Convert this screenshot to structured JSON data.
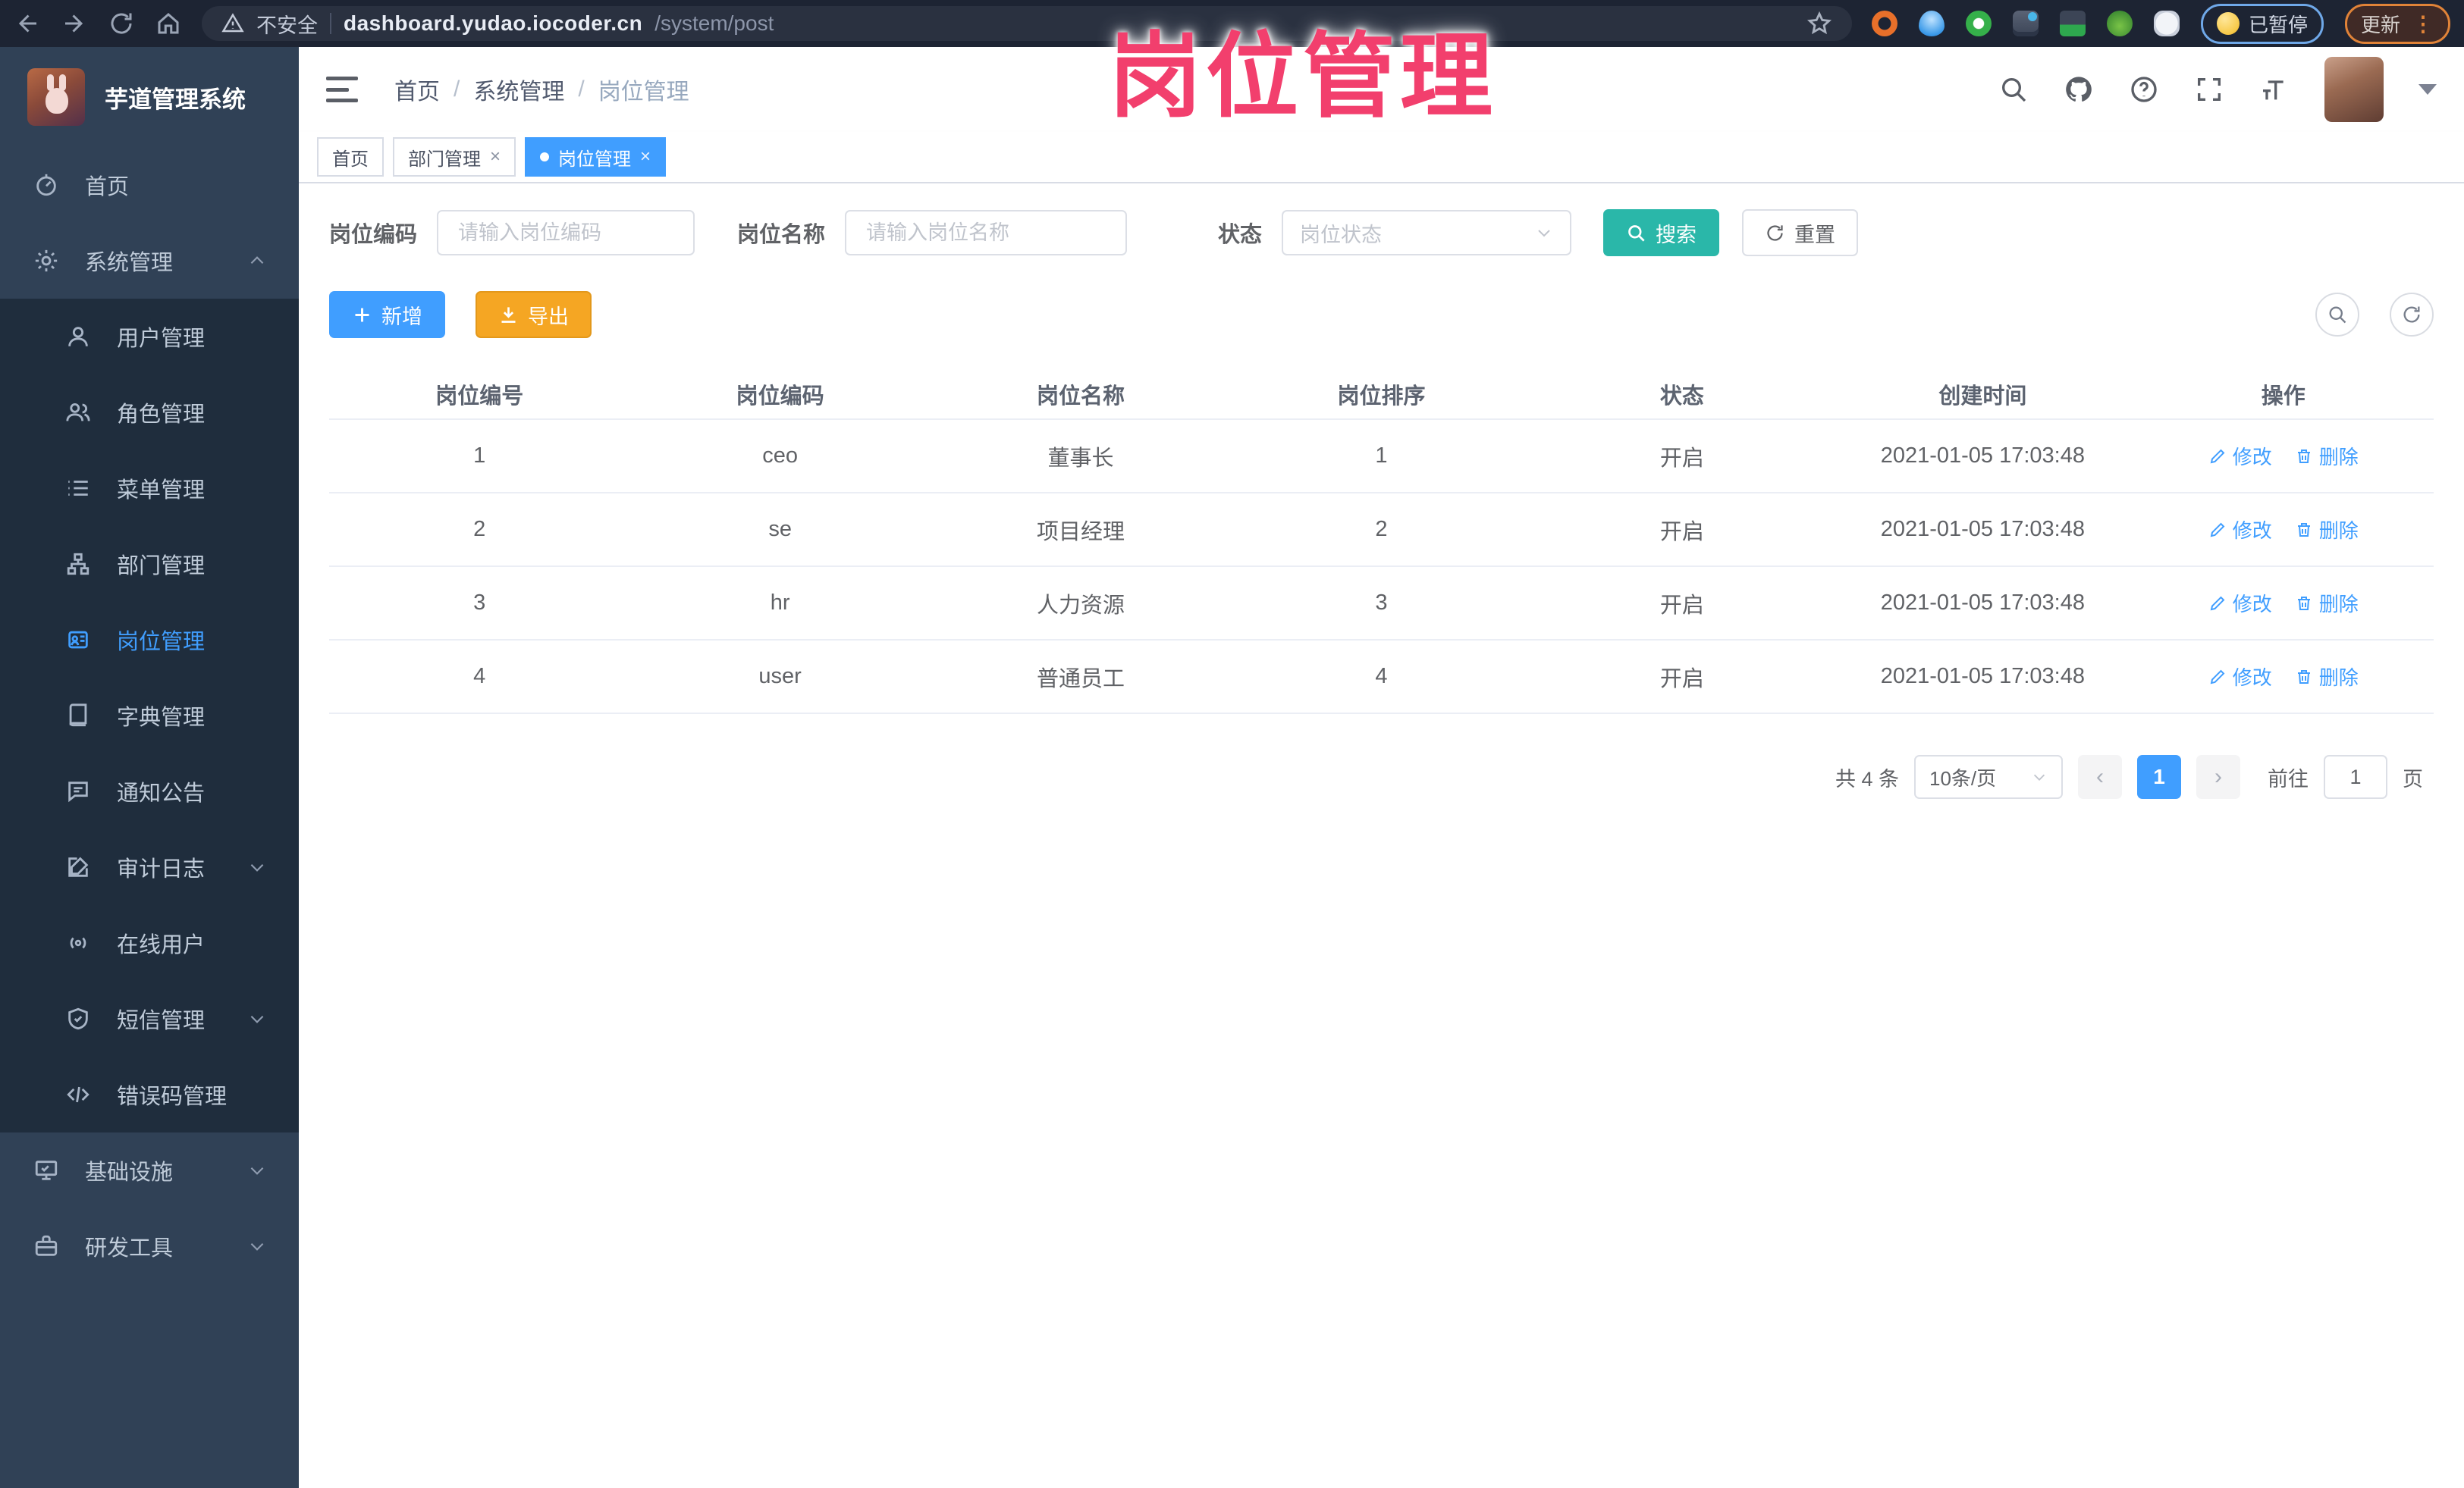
{
  "watermark_text": "岗位管理",
  "browser": {
    "security_label": "不安全",
    "url_host": "dashboard.yudao.iocoder.cn",
    "url_path": "/system/post",
    "paused_badge": "已暂停",
    "update_button": "更新",
    "kebab": "⋮"
  },
  "sidebar": {
    "app_title": "芋道管理系统",
    "menu": [
      {
        "label": "首页"
      },
      {
        "label": "系统管理"
      },
      {
        "label": "用户管理"
      },
      {
        "label": "角色管理"
      },
      {
        "label": "菜单管理"
      },
      {
        "label": "部门管理"
      },
      {
        "label": "岗位管理"
      },
      {
        "label": "字典管理"
      },
      {
        "label": "通知公告"
      },
      {
        "label": "审计日志"
      },
      {
        "label": "在线用户"
      },
      {
        "label": "短信管理"
      },
      {
        "label": "错误码管理"
      },
      {
        "label": "基础设施"
      },
      {
        "label": "研发工具"
      }
    ]
  },
  "header": {
    "breadcrumb": {
      "home": "首页",
      "section": "系统管理",
      "current": "岗位管理",
      "separator": "/"
    }
  },
  "tabs": [
    {
      "label": "首页"
    },
    {
      "label": "部门管理",
      "close": "×"
    },
    {
      "label": "岗位管理",
      "close": "×"
    }
  ],
  "filters": {
    "code_label": "岗位编码",
    "code_placeholder": "请输入岗位编码",
    "name_label": "岗位名称",
    "name_placeholder": "请输入岗位名称",
    "status_label": "状态",
    "status_placeholder": "岗位状态",
    "search_button": "搜索",
    "reset_button": "重置"
  },
  "toolbar": {
    "add_button": "新增",
    "export_button": "导出"
  },
  "table": {
    "columns": [
      "岗位编号",
      "岗位编码",
      "岗位名称",
      "岗位排序",
      "状态",
      "创建时间",
      "操作"
    ],
    "edit_label": "修改",
    "delete_label": "删除",
    "rows": [
      {
        "id": "1",
        "code": "ceo",
        "name": "董事长",
        "sort": "1",
        "status": "开启",
        "created": "2021-01-05 17:03:48"
      },
      {
        "id": "2",
        "code": "se",
        "name": "项目经理",
        "sort": "2",
        "status": "开启",
        "created": "2021-01-05 17:03:48"
      },
      {
        "id": "3",
        "code": "hr",
        "name": "人力资源",
        "sort": "3",
        "status": "开启",
        "created": "2021-01-05 17:03:48"
      },
      {
        "id": "4",
        "code": "user",
        "name": "普通员工",
        "sort": "4",
        "status": "开启",
        "created": "2021-01-05 17:03:48"
      }
    ]
  },
  "pagination": {
    "total": "共 4 条",
    "page_size": "10条/页",
    "prev": "‹",
    "next": "›",
    "page": "1",
    "goto_label": "前往",
    "goto_value": "1",
    "unit_label": "页"
  },
  "colors": {
    "accent": "#409EFF",
    "search_teal": "#2AB7A9",
    "export_orange": "#F5A623",
    "watermark_pink": "#F23F6D",
    "sidebar_bg": "#304156",
    "submenu_bg": "#1F2D3D"
  }
}
